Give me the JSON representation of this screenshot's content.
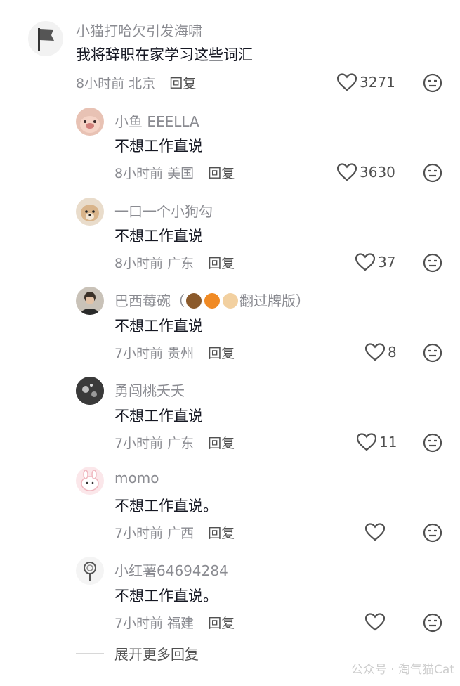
{
  "comments": [
    {
      "user": "小猫打哈欠引发海啸",
      "text": "我将辞职在家学习这些词汇",
      "time": "8小时前",
      "location": "北京",
      "reply": "回复",
      "likes": "3271"
    },
    {
      "user": "小鱼 EEELLA",
      "text": "不想工作直说",
      "time": "8小时前",
      "location": "美国",
      "reply": "回复",
      "likes": "3630"
    },
    {
      "user": "一口一个小狗勾",
      "text": "不想工作直说",
      "time": "8小时前",
      "location": "广东",
      "reply": "回复",
      "likes": "37"
    },
    {
      "user_prefix": "巴西莓碗（",
      "user_suffix": "翻过牌版）",
      "text": "不想工作直说",
      "time": "7小时前",
      "location": "贵州",
      "reply": "回复",
      "likes": "8"
    },
    {
      "user": "勇闯桃夭夭",
      "text": "不想工作直说",
      "time": "7小时前",
      "location": "广东",
      "reply": "回复",
      "likes": "11"
    },
    {
      "user": "momo",
      "text": "不想工作直说。",
      "time": "7小时前",
      "location": "广西",
      "reply": "回复",
      "likes": ""
    },
    {
      "user": "小红薯64694284",
      "text": "不想工作直说。",
      "time": "7小时前",
      "location": "福建",
      "reply": "回复",
      "likes": ""
    }
  ],
  "expand_label": "展开更多回复",
  "watermark": "公众号 · 淘气猫Cat",
  "icons": {
    "like": "heart-outline-icon",
    "dislike": "meh-face-icon"
  }
}
